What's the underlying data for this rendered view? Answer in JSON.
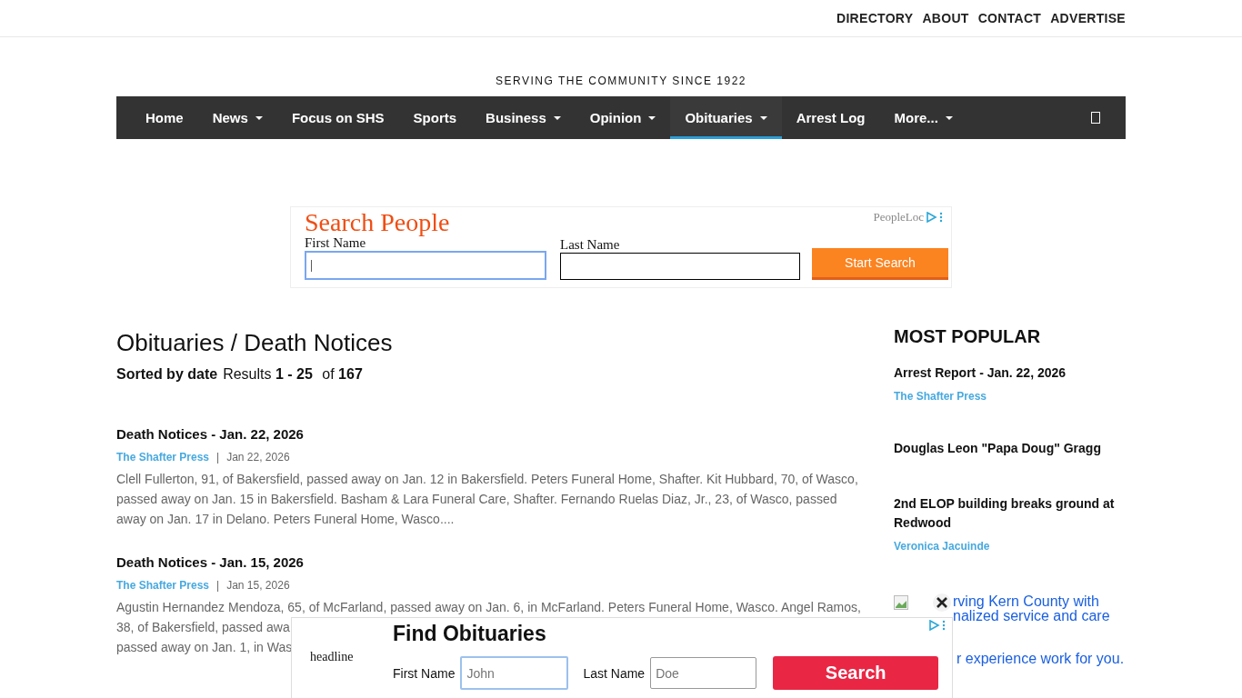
{
  "top_links": [
    "DIRECTORY",
    "ABOUT",
    "CONTACT",
    "ADVERTISE"
  ],
  "tagline": "SERVING THE COMMUNITY SINCE 1922",
  "nav": [
    {
      "label": "Home",
      "dropdown": false,
      "selected": false
    },
    {
      "label": "News",
      "dropdown": true,
      "selected": false
    },
    {
      "label": "Focus on SHS",
      "dropdown": false,
      "selected": false
    },
    {
      "label": "Sports",
      "dropdown": false,
      "selected": false
    },
    {
      "label": "Business",
      "dropdown": true,
      "selected": false
    },
    {
      "label": "Opinion",
      "dropdown": true,
      "selected": false
    },
    {
      "label": "Obituaries",
      "dropdown": true,
      "selected": true
    },
    {
      "label": "Arrest Log",
      "dropdown": false,
      "selected": false
    },
    {
      "label": "More...",
      "dropdown": true,
      "selected": false
    }
  ],
  "top_ad": {
    "title": "Search People",
    "advertiser": "PeopleLoc",
    "first_label": "First Name",
    "first_value": "|",
    "last_label": "Last Name",
    "button": "Start Search"
  },
  "page_title": "Obituaries / Death Notices",
  "sort_label": "Sorted by date",
  "results": "Results **1 - 25** of **167**",
  "articles": [
    {
      "title": "Death Notices - Jan. 22, 2026",
      "source": "The Shafter Press",
      "separator": "|",
      "date": "Jan 22, 2026",
      "lines": [
        "Clell Fullerton, 91, of Bakersfield, passed away on Jan. 12 in Bakersfield. Peters Funeral Home, Shafter. Kit Hubbard, 70, of Wasco,",
        "passed away on Jan. 15 in Bakersfield. Basham & Lara Funeral Care, Shafter. Fernando Ruelas Diaz, Jr., 23, of Wasco, passed",
        "away on Jan. 17 in Delano. Peters Funeral Home, Wasco...."
      ]
    },
    {
      "title": "Death Notices - Jan. 15, 2026",
      "source": "The Shafter Press",
      "separator": "|",
      "date": "Jan 15, 2026",
      "lines": [
        "Agustin Hernandez Mendoza, 65, of McFarland, passed away on Jan. 6, in McFarland. Peters Funeral Home, Wasco. Angel Ramos,",
        "38, of Bakersfield, passed awa",
        "passed away on Jan. 1, in Was"
      ]
    }
  ],
  "sidebar": {
    "heading": "MOST POPULAR",
    "items": [
      {
        "title": "Arrest Report - Jan. 22, 2026",
        "byline": "The Shafter Press"
      },
      {
        "title": "Douglas Leon \"Papa Doug\" Gragg"
      },
      {
        "title": "2nd ELOP building breaks ground at Redwood",
        "byline": "Veronica Jacuinde"
      }
    ],
    "ad_lines": [
      "rving Kern County with",
      "nalized service and care"
    ],
    "ad_tail": "r experience work for you."
  },
  "bottom_ad": {
    "image_alt": "headline",
    "title": "Find Obituaries",
    "first_label": "First Name",
    "first_placeholder": "John",
    "last_label": "Last Name",
    "last_placeholder": "Doe",
    "button": "Search"
  }
}
